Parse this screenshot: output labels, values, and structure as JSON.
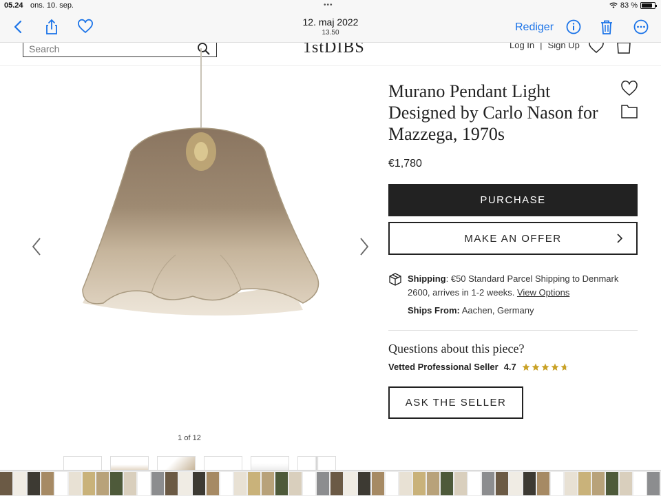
{
  "status_bar": {
    "time": "05.24",
    "date": "ons. 10. sep.",
    "dots": "•••",
    "battery_text": "83 %",
    "battery_level": 0.83
  },
  "toolbar": {
    "date_title": "12. maj 2022",
    "time_subtitle": "13.50",
    "edit_label": "Rediger"
  },
  "site_header": {
    "search_placeholder": "Search",
    "logo": "1stDIBS",
    "login": "Log In",
    "separator": "|",
    "signup": "Sign Up"
  },
  "gallery": {
    "counter": "1 of 12"
  },
  "product": {
    "title": "Murano Pendant Light Designed by Carlo Nason for Mazzega, 1970s",
    "price": "€1,780",
    "purchase_label": "PURCHASE",
    "offer_label": "MAKE AN OFFER",
    "shipping_label": "Shipping",
    "shipping_text": ": €50 Standard Parcel Shipping to Denmark 2600, arrives in 1-2 weeks. ",
    "view_options": "View Options",
    "ships_from_label": "Ships From:",
    "ships_from_value": " Aachen, Germany",
    "questions": "Questions about this piece?",
    "seller_label": "Vetted Professional Seller",
    "seller_rating": "4.7",
    "ask_label": "ASK THE SELLER"
  },
  "colors": {
    "accent_blue": "#1a73e8",
    "button_dark": "#222222",
    "star_gold": "#c9a227"
  }
}
